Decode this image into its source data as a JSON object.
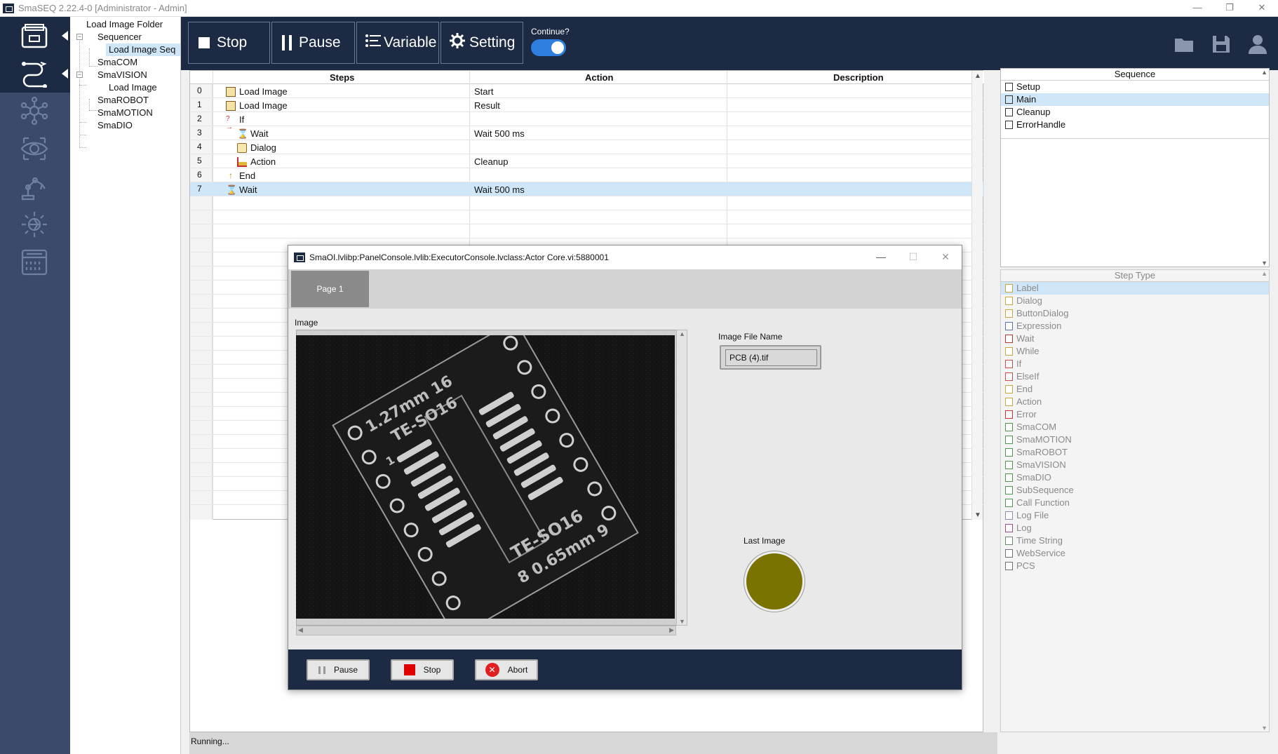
{
  "window": {
    "title": "SmaSEQ 2.22.4-0 [Administrator - Admin]",
    "controls": [
      "—",
      "❐",
      "✕"
    ]
  },
  "rail": {
    "icons": [
      "folder-icon",
      "sequence-icon",
      "network-icon",
      "vision-eye-icon",
      "robot-arm-icon",
      "motion-gear-icon",
      "io-panel-icon"
    ]
  },
  "tree": {
    "items": [
      {
        "label": "Load Image Folder"
      },
      {
        "label": "Sequencer"
      },
      {
        "label": "Load Image Seq"
      },
      {
        "label": "SmaCOM"
      },
      {
        "label": "SmaVISION"
      },
      {
        "label": "Load Image"
      },
      {
        "label": "SmaROBOT"
      },
      {
        "label": "SmaMOTION"
      },
      {
        "label": "SmaDIO"
      }
    ]
  },
  "toolbar": {
    "stop_label": "Stop",
    "pause_label": "Pause",
    "variable_label": "Variable",
    "setting_label": "Setting",
    "continue_label": "Continue?",
    "continue_on": true
  },
  "steps": {
    "headers": {
      "steps": "Steps",
      "action": "Action",
      "description": "Description"
    },
    "rows": [
      {
        "index": "0",
        "name": "Load Image",
        "action": "Start",
        "icon": "load-image-icon"
      },
      {
        "index": "1",
        "name": "Load Image",
        "action": "Result",
        "icon": "load-image-icon"
      },
      {
        "index": "2",
        "name": "If",
        "action": "",
        "icon": "if-icon"
      },
      {
        "index": "3",
        "name": "Wait",
        "action": "Wait 500 ms",
        "icon": "hourglass-icon"
      },
      {
        "index": "4",
        "name": "Dialog",
        "action": "",
        "icon": "dialog-icon"
      },
      {
        "index": "5",
        "name": "Action",
        "action": "Cleanup",
        "icon": "action-icon"
      },
      {
        "index": "6",
        "name": "End",
        "action": "",
        "icon": "end-icon"
      },
      {
        "index": "7",
        "name": "Wait",
        "action": "Wait 500 ms",
        "icon": "hourglass-icon"
      }
    ]
  },
  "status": {
    "text": "Running..."
  },
  "sequence_panel": {
    "header": "Sequence",
    "items": [
      {
        "label": "Setup"
      },
      {
        "label": "Main"
      },
      {
        "label": "Cleanup"
      },
      {
        "label": "ErrorHandle"
      }
    ]
  },
  "steptype_panel": {
    "header": "Step Type",
    "items": [
      {
        "label": "Label",
        "color": "#c9a640"
      },
      {
        "label": "Dialog",
        "color": "#c9a640"
      },
      {
        "label": "ButtonDialog",
        "color": "#c9a640"
      },
      {
        "label": "Expression",
        "color": "#5b6fc0"
      },
      {
        "label": "Wait",
        "color": "#b33a3a"
      },
      {
        "label": "While",
        "color": "#c9a640"
      },
      {
        "label": "If",
        "color": "#d04a4a"
      },
      {
        "label": "ElseIf",
        "color": "#d04a4a"
      },
      {
        "label": "End",
        "color": "#c9a640"
      },
      {
        "label": "Action",
        "color": "#c9a640"
      },
      {
        "label": "Error",
        "color": "#d83030"
      },
      {
        "label": "SmaCOM",
        "color": "#4a9a4a"
      },
      {
        "label": "SmaMOTION",
        "color": "#4a9a4a"
      },
      {
        "label": "SmaROBOT",
        "color": "#4a9a4a"
      },
      {
        "label": "SmaVISION",
        "color": "#4a9a4a"
      },
      {
        "label": "SmaDIO",
        "color": "#4a9a4a"
      },
      {
        "label": "SubSequence",
        "color": "#4a9a4a"
      },
      {
        "label": "Call Function",
        "color": "#4a9a4a"
      },
      {
        "label": "Log File",
        "color": "#8a8aaa"
      },
      {
        "label": "Log",
        "color": "#a04a8a"
      },
      {
        "label": "Time String",
        "color": "#6a8a6a"
      },
      {
        "label": "WebService",
        "color": "#707070"
      },
      {
        "label": "PCS",
        "color": "#707070"
      }
    ]
  },
  "dialog": {
    "title": "SmaOI.lvlibp:PanelConsole.lvlib:ExecutorConsole.lvclass:Actor Core.vi:5880001",
    "controls": [
      "—",
      "☐",
      "✕"
    ],
    "tab_label": "Page 1",
    "image_label": "Image",
    "file_name_label": "Image File Name",
    "file_name_value": "PCB (4).tif",
    "last_image_label": "Last Image",
    "led_color": "#7a7300",
    "pause_label": "Pause",
    "stop_label": "Stop",
    "abort_label": "Abort",
    "pcb_text": {
      "top_left": "1.27mm 16",
      "top_mid": "TE-SO16",
      "pin_one": "1",
      "bottom_mid": "TE-SO16",
      "bottom_left": "8 0.65mm 9"
    }
  }
}
